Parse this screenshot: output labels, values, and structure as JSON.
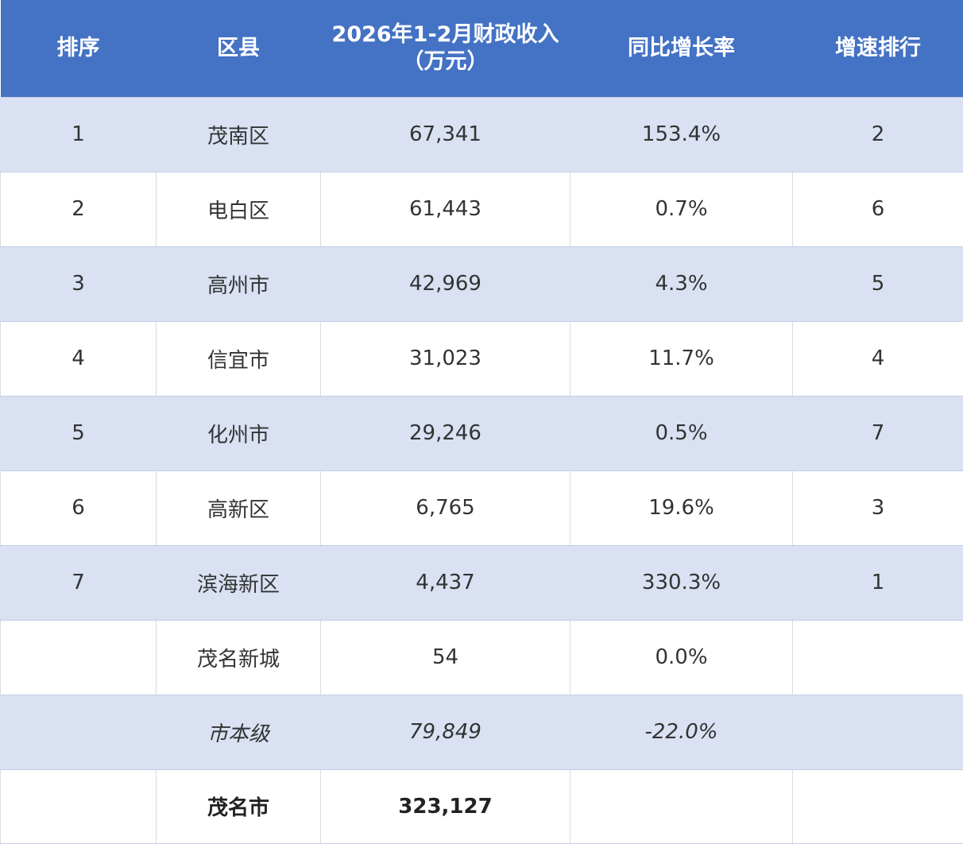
{
  "headers": {
    "rank": "排序",
    "district": "区县",
    "revenue_line1": "2026年1-2月财政收入",
    "revenue_line2": "（万元）",
    "growth": "同比增长率",
    "growth_rank": "增速排行"
  },
  "rows": [
    {
      "rank": "1",
      "district": "茂南区",
      "revenue": "67,341",
      "growth": "153.4%",
      "growth_rank": "2"
    },
    {
      "rank": "2",
      "district": "电白区",
      "revenue": "61,443",
      "growth": "0.7%",
      "growth_rank": "6"
    },
    {
      "rank": "3",
      "district": "高州市",
      "revenue": "42,969",
      "growth": "4.3%",
      "growth_rank": "5"
    },
    {
      "rank": "4",
      "district": "信宜市",
      "revenue": "31,023",
      "growth": "11.7%",
      "growth_rank": "4"
    },
    {
      "rank": "5",
      "district": "化州市",
      "revenue": "29,246",
      "growth": "0.5%",
      "growth_rank": "7"
    },
    {
      "rank": "6",
      "district": "高新区",
      "revenue": "6,765",
      "growth": "19.6%",
      "growth_rank": "3"
    },
    {
      "rank": "7",
      "district": "滨海新区",
      "revenue": "4,437",
      "growth": "330.3%",
      "growth_rank": "1"
    },
    {
      "rank": "",
      "district": "茂名新城",
      "revenue": "54",
      "growth": "0.0%",
      "growth_rank": ""
    },
    {
      "rank": "",
      "district": "市本级",
      "revenue": "79,849",
      "growth": "-22.0%",
      "growth_rank": ""
    },
    {
      "rank": "",
      "district": "茂名市",
      "revenue": "323,127",
      "growth": "",
      "growth_rank": ""
    }
  ],
  "colors": {
    "header_bg": "#4472c4",
    "band_bg": "#d9e1f2",
    "plain_bg": "#ffffff"
  }
}
